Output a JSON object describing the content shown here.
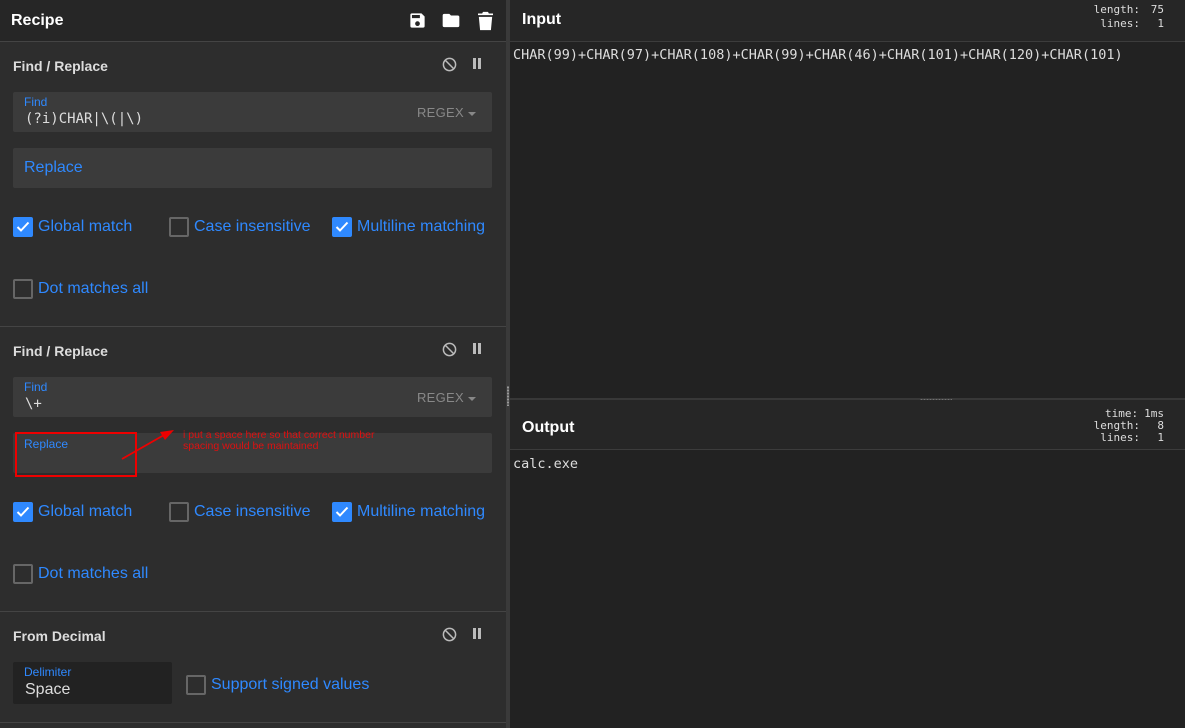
{
  "recipe": {
    "title": "Recipe",
    "header_icons": [
      "save-icon",
      "folder-open-icon",
      "trash-icon"
    ]
  },
  "operations": [
    {
      "title": "Find / Replace",
      "find_label": "Find",
      "find_value": "(?i)CHAR|\\(|\\)",
      "find_mode": "REGEX",
      "replace_placeholder": "Replace",
      "options": [
        {
          "label": "Global match",
          "checked": true
        },
        {
          "label": "Case insensitive",
          "checked": false
        },
        {
          "label": "Multiline matching",
          "checked": true
        },
        {
          "label": "Dot matches all",
          "checked": false
        }
      ]
    },
    {
      "title": "Find / Replace",
      "find_label": "Find",
      "find_value": "\\+",
      "find_mode": "REGEX",
      "replace_label": "Replace",
      "replace_value": " ",
      "options": [
        {
          "label": "Global match",
          "checked": true
        },
        {
          "label": "Case insensitive",
          "checked": false
        },
        {
          "label": "Multiline matching",
          "checked": true
        },
        {
          "label": "Dot matches all",
          "checked": false
        }
      ]
    },
    {
      "title": "From Decimal",
      "delimiter_label": "Delimiter",
      "delimiter_value": "Space",
      "options": [
        {
          "label": "Support signed values",
          "checked": false
        }
      ]
    }
  ],
  "annotation": {
    "text_line1": "i put a space here so that correct number",
    "text_line2": "spacing would be maintained",
    "color": "#e00000"
  },
  "input": {
    "title": "Input",
    "stats": {
      "length_label": "length:",
      "length": "75",
      "lines_label": "lines:",
      "lines": "1"
    },
    "text": "CHAR(99)+CHAR(97)+CHAR(108)+CHAR(99)+CHAR(46)+CHAR(101)+CHAR(120)+CHAR(101)"
  },
  "output": {
    "title": "Output",
    "stats": {
      "time_label": "time:",
      "time": "1ms",
      "length_label": "length:",
      "length": "8",
      "lines_label": "lines:",
      "lines": "1"
    },
    "text": "calc.exe"
  },
  "colors": {
    "accent": "#2f89ff",
    "panel": "#2d2d2d",
    "field": "#3b3b3b",
    "background": "#222222"
  }
}
